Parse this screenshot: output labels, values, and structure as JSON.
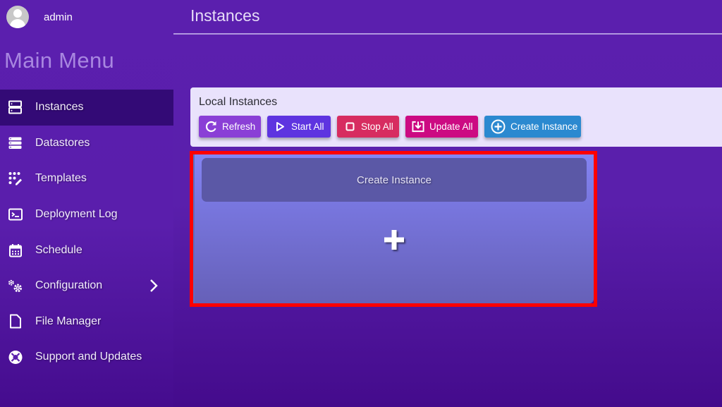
{
  "user": {
    "name": "admin",
    "avatar_icon": "user-avatar-icon"
  },
  "sidebar": {
    "title": "Main Menu",
    "items": [
      {
        "label": "Instances",
        "icon": "server-icon",
        "active": true
      },
      {
        "label": "Datastores",
        "icon": "database-icon",
        "active": false
      },
      {
        "label": "Templates",
        "icon": "template-icon",
        "active": false
      },
      {
        "label": "Deployment Log",
        "icon": "terminal-icon",
        "active": false
      },
      {
        "label": "Schedule",
        "icon": "calendar-icon",
        "active": false
      },
      {
        "label": "Configuration",
        "icon": "gears-icon",
        "active": false,
        "has_submenu": true
      },
      {
        "label": "File Manager",
        "icon": "file-icon",
        "active": false
      },
      {
        "label": "Support and Updates",
        "icon": "lifebuoy-icon",
        "active": false
      }
    ]
  },
  "header": {
    "title": "Instances"
  },
  "panel": {
    "title": "Local Instances",
    "buttons": [
      {
        "label": "Refresh",
        "icon": "refresh-icon",
        "color": "#8a3fd6"
      },
      {
        "label": "Start All",
        "icon": "play-icon",
        "color": "#5e34e0"
      },
      {
        "label": "Stop All",
        "icon": "stop-icon",
        "color": "#d72c60"
      },
      {
        "label": "Update All",
        "icon": "download-icon",
        "color": "#cc0a82"
      },
      {
        "label": "Create Instance",
        "icon": "plus-circle-icon",
        "color": "#2b89d0"
      }
    ]
  },
  "create_card": {
    "title": "Create Instance",
    "icon": "plus-icon",
    "highlight_color": "#ff0000"
  }
}
